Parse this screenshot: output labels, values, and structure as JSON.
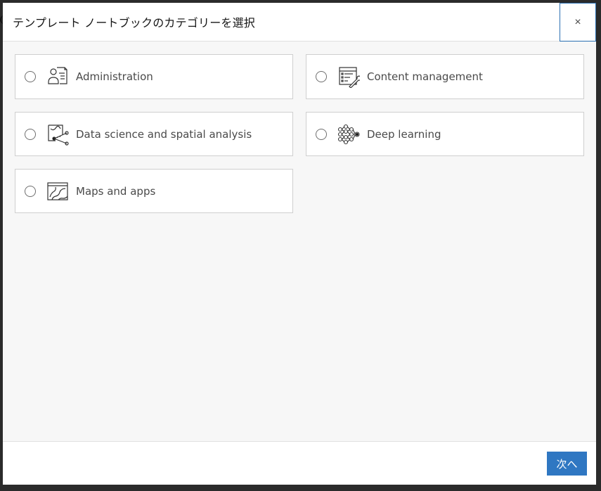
{
  "dialog": {
    "title": "テンプレート ノートブックのカテゴリーを選択",
    "close_symbol": "×",
    "next_label": "次へ"
  },
  "categories": [
    {
      "label": "Administration",
      "icon": "administration-icon",
      "selected": false
    },
    {
      "label": "Content management",
      "icon": "content-management-icon",
      "selected": false
    },
    {
      "label": "Data science and spatial analysis",
      "icon": "data-science-icon",
      "selected": false
    },
    {
      "label": "Deep learning",
      "icon": "deep-learning-icon",
      "selected": false
    },
    {
      "label": "Maps and apps",
      "icon": "maps-and-apps-icon",
      "selected": false
    }
  ],
  "colors": {
    "primary": "#2f77c2",
    "focus_border": "#2a6fb2",
    "card_border": "#cfcfcf",
    "body_bg": "#f7f7f7"
  }
}
